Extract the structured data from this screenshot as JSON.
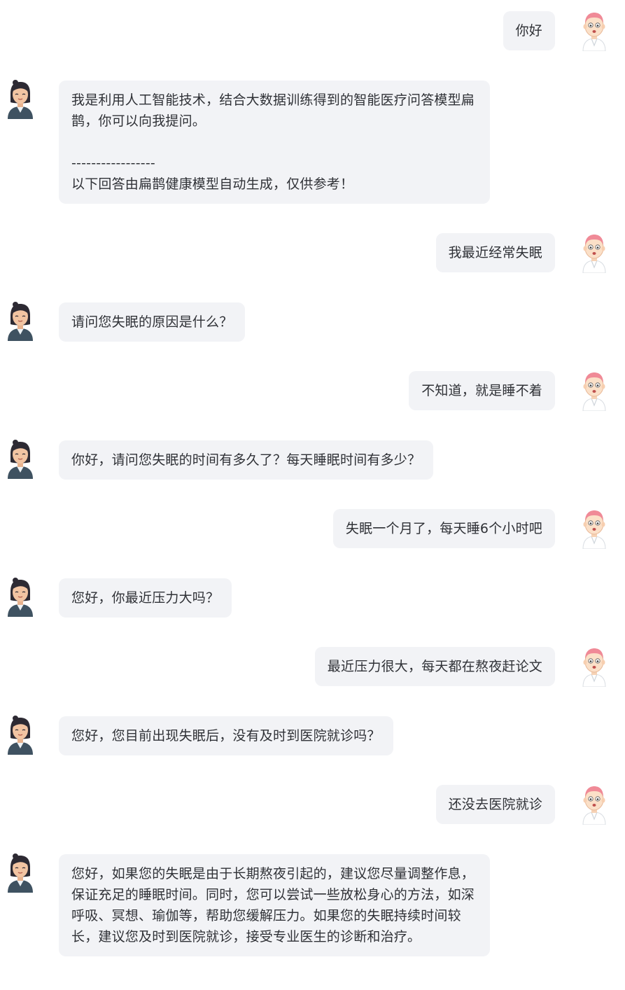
{
  "conversation": {
    "messages": [
      {
        "role": "user",
        "text": "你好"
      },
      {
        "role": "bot",
        "text": "我是利用人工智能技术，结合大数据训练得到的智能医疗问答模型扁鹊，你可以向我提问。\n\n-----------------\n以下回答由扁鹊健康模型自动生成，仅供参考！"
      },
      {
        "role": "user",
        "text": "我最近经常失眠"
      },
      {
        "role": "bot",
        "text": "请问您失眠的原因是什么？"
      },
      {
        "role": "user",
        "text": "不知道，就是睡不着"
      },
      {
        "role": "bot",
        "text": "你好，请问您失眠的时间有多久了？每天睡眠时间有多少？"
      },
      {
        "role": "user",
        "text": "失眠一个月了，每天睡6个小时吧"
      },
      {
        "role": "bot",
        "text": "您好，你最近压力大吗？"
      },
      {
        "role": "user",
        "text": "最近压力很大，每天都在熬夜赶论文"
      },
      {
        "role": "bot",
        "text": "您好，您目前出现失眠后，没有及时到医院就诊吗？"
      },
      {
        "role": "user",
        "text": "还没去医院就诊"
      },
      {
        "role": "bot",
        "text": "您好，如果您的失眠是由于长期熬夜引起的，建议您尽量调整作息，保证充足的睡眠时间。同时，您可以尝试一些放松身心的方法，如深呼吸、冥想、瑜伽等，帮助您缓解压力。如果您的失眠持续时间较长，建议您及时到医院就诊，接受专业医生的诊断和治疗。"
      }
    ]
  },
  "colors": {
    "bubble_bg": "#f2f3f6",
    "text": "#2f3136",
    "user_hair": "#f08a97",
    "bot_hair": "#2d2a33",
    "bot_coat": "#3f5261"
  },
  "icons": {
    "user_avatar": "doctor-avatar-icon",
    "bot_avatar": "female-assistant-avatar-icon"
  }
}
